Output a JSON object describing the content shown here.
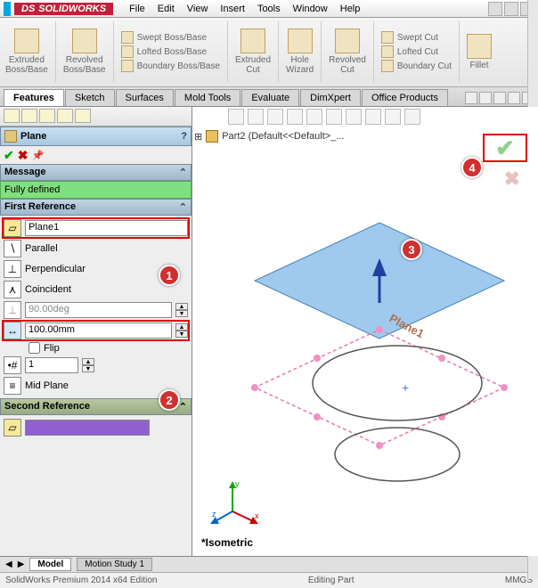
{
  "app": {
    "name": "SOLIDWORKS"
  },
  "menubar": [
    "File",
    "Edit",
    "View",
    "Insert",
    "Tools",
    "Window",
    "Help"
  ],
  "ribbon": {
    "extruded_boss": "Extruded\nBoss/Base",
    "revolved_boss": "Revolved\nBoss/Base",
    "swept_boss": "Swept Boss/Base",
    "lofted_boss": "Lofted Boss/Base",
    "boundary_boss": "Boundary Boss/Base",
    "extruded_cut": "Extruded\nCut",
    "hole_wizard": "Hole\nWizard",
    "revolved_cut": "Revolved\nCut",
    "swept_cut": "Swept Cut",
    "lofted_cut": "Lofted Cut",
    "boundary_cut": "Boundary Cut",
    "fillet": "Fillet"
  },
  "tabs": [
    "Features",
    "Sketch",
    "Surfaces",
    "Mold Tools",
    "Evaluate",
    "DimXpert",
    "Office Products"
  ],
  "active_tab": "Features",
  "panel": {
    "title": "Plane",
    "message_hdr": "Message",
    "message_val": "Fully defined",
    "ref1_hdr": "First Reference",
    "ref1_value": "Plane1",
    "parallel": "Parallel",
    "perpendicular": "Perpendicular",
    "coincident": "Coincident",
    "angle": "90.00deg",
    "distance": "100.00mm",
    "flip": "Flip",
    "instances": "1",
    "midplane": "Mid Plane",
    "ref2_hdr": "Second Reference"
  },
  "tree": {
    "part": "Part2 (Default<<Default>_..."
  },
  "viewport": {
    "plane_label": "Plane1",
    "iso": "*Isometric",
    "axes": {
      "x": "x",
      "y": "y",
      "z": "z"
    }
  },
  "callouts": {
    "c1": "1",
    "c2": "2",
    "c3": "3",
    "c4": "4"
  },
  "bottom_tabs": {
    "model": "Model",
    "motion": "Motion Study 1"
  },
  "status": {
    "left": "SolidWorks Premium 2014 x64 Edition",
    "mid": "Editing Part",
    "units": "MMGS"
  }
}
